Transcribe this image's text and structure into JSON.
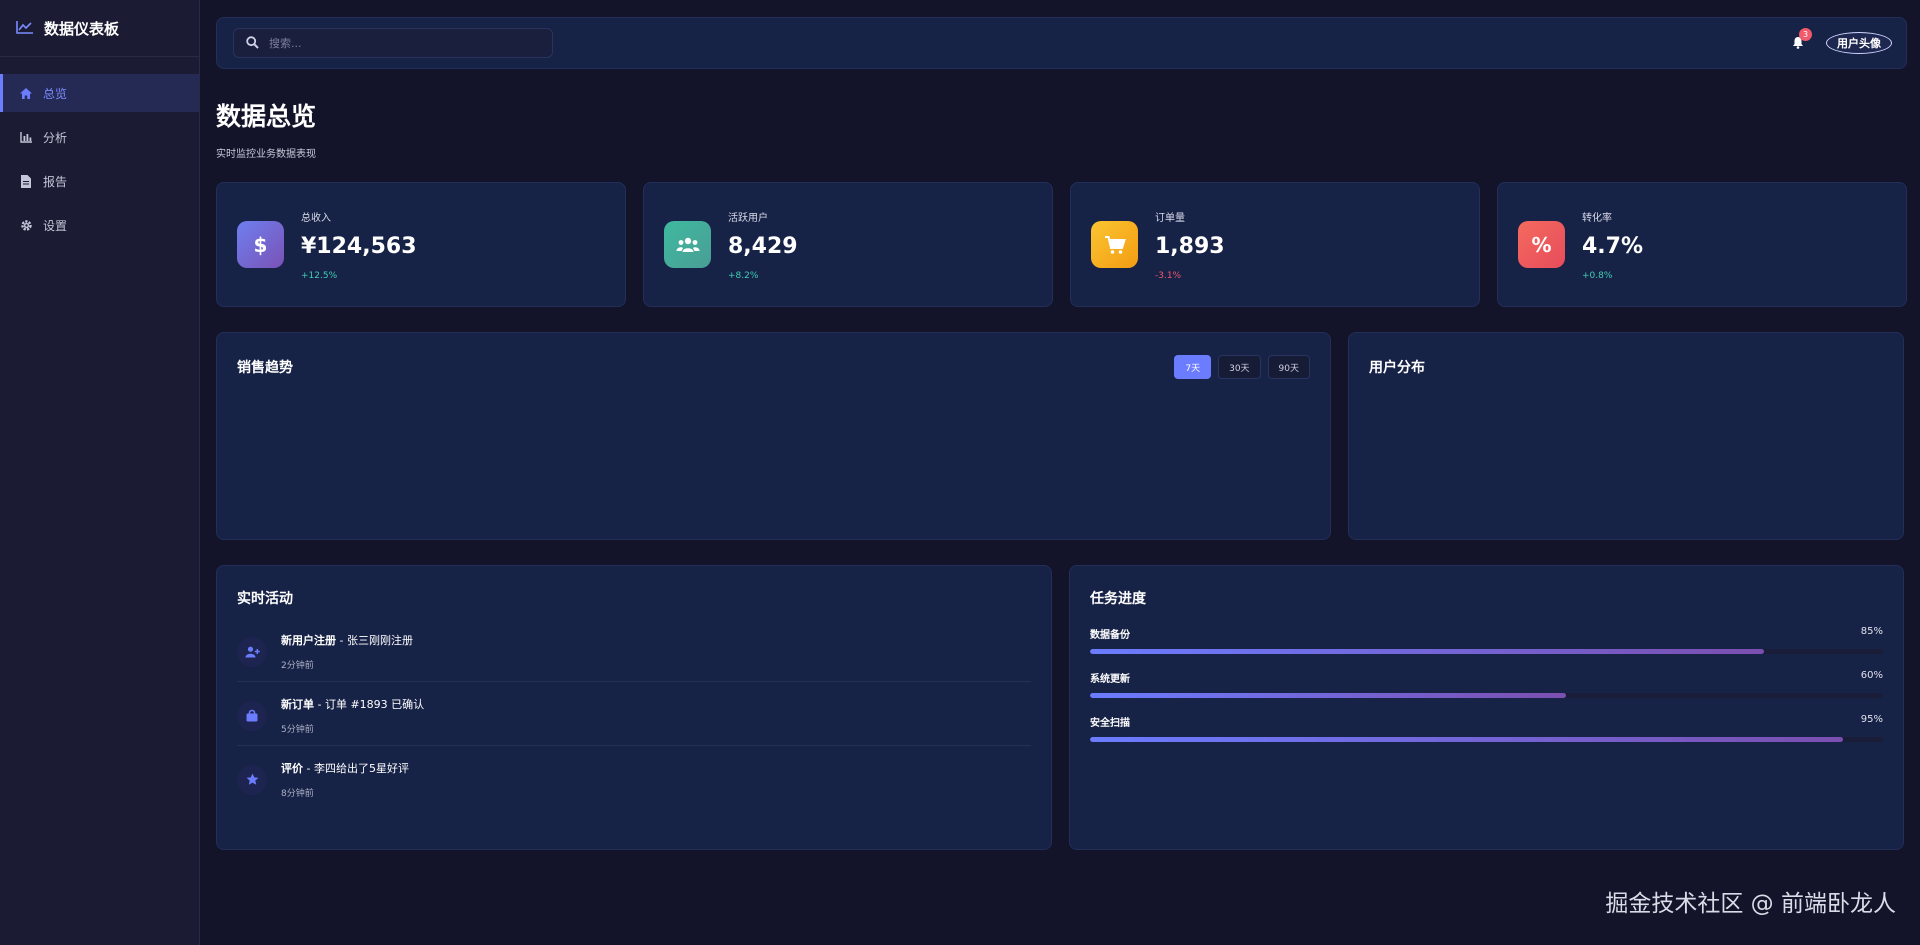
{
  "brand": {
    "title": "数据仪表板",
    "icon": "chart-line-icon"
  },
  "sidebar": {
    "items": [
      {
        "label": "总览",
        "icon": "home-icon",
        "active": true
      },
      {
        "label": "分析",
        "icon": "bar-chart-icon",
        "active": false
      },
      {
        "label": "报告",
        "icon": "document-icon",
        "active": false
      },
      {
        "label": "设置",
        "icon": "gear-icon",
        "active": false
      }
    ]
  },
  "topbar": {
    "search_placeholder": "搜索...",
    "notification_count": "3",
    "avatar_alt": "用户头像"
  },
  "page": {
    "title": "数据总览",
    "subtitle": "实时监控业务数据表现"
  },
  "stats": [
    {
      "label": "总收入",
      "value": "¥124,563",
      "change": "+12.5%",
      "trend": "up",
      "icon": "dollar-icon",
      "glyph": "$",
      "gradient": [
        "#6e7ff0",
        "#7a52b5"
      ]
    },
    {
      "label": "活跃用户",
      "value": "8,429",
      "change": "+8.2%",
      "trend": "up",
      "icon": "users-icon",
      "glyph": "",
      "gradient": [
        "#3fb9a0",
        "#4a9e95"
      ]
    },
    {
      "label": "订单量",
      "value": "1,893",
      "change": "-3.1%",
      "trend": "down",
      "icon": "cart-icon",
      "glyph": "",
      "gradient": [
        "#fbc531",
        "#f39c12"
      ]
    },
    {
      "label": "转化率",
      "value": "4.7%",
      "change": "+0.8%",
      "trend": "up",
      "icon": "percent-icon",
      "glyph": "%",
      "gradient": [
        "#f46a5e",
        "#e74c5c"
      ]
    }
  ],
  "colors": {
    "up": "#3ecfb0",
    "down": "#f0566a",
    "accent": "#6b7cff"
  },
  "sales_panel": {
    "title": "销售趋势",
    "ranges": [
      {
        "label": "7天",
        "active": true
      },
      {
        "label": "30天",
        "active": false
      },
      {
        "label": "90天",
        "active": false
      }
    ]
  },
  "distribution_panel": {
    "title": "用户分布"
  },
  "activity_panel": {
    "title": "实时活动",
    "items": [
      {
        "title": "新用户注册",
        "detail": " - 张三刚刚注册",
        "time": "2分钟前",
        "icon": "user-plus-icon"
      },
      {
        "title": "新订单",
        "detail": " - 订单 #1893 已确认",
        "time": "5分钟前",
        "icon": "shopping-bag-icon"
      },
      {
        "title": "评价",
        "detail": " - 李四给出了5星好评",
        "time": "8分钟前",
        "icon": "star-icon"
      }
    ]
  },
  "tasks_panel": {
    "title": "任务进度",
    "tasks": [
      {
        "name": "数据备份",
        "percent_label": "85%",
        "progress": 0.85
      },
      {
        "name": "系统更新",
        "percent_label": "60%",
        "progress": 0.6
      },
      {
        "name": "安全扫描",
        "percent_label": "95%",
        "progress": 0.95
      }
    ]
  },
  "watermark": "掘金技术社区 @ 前端卧龙人"
}
